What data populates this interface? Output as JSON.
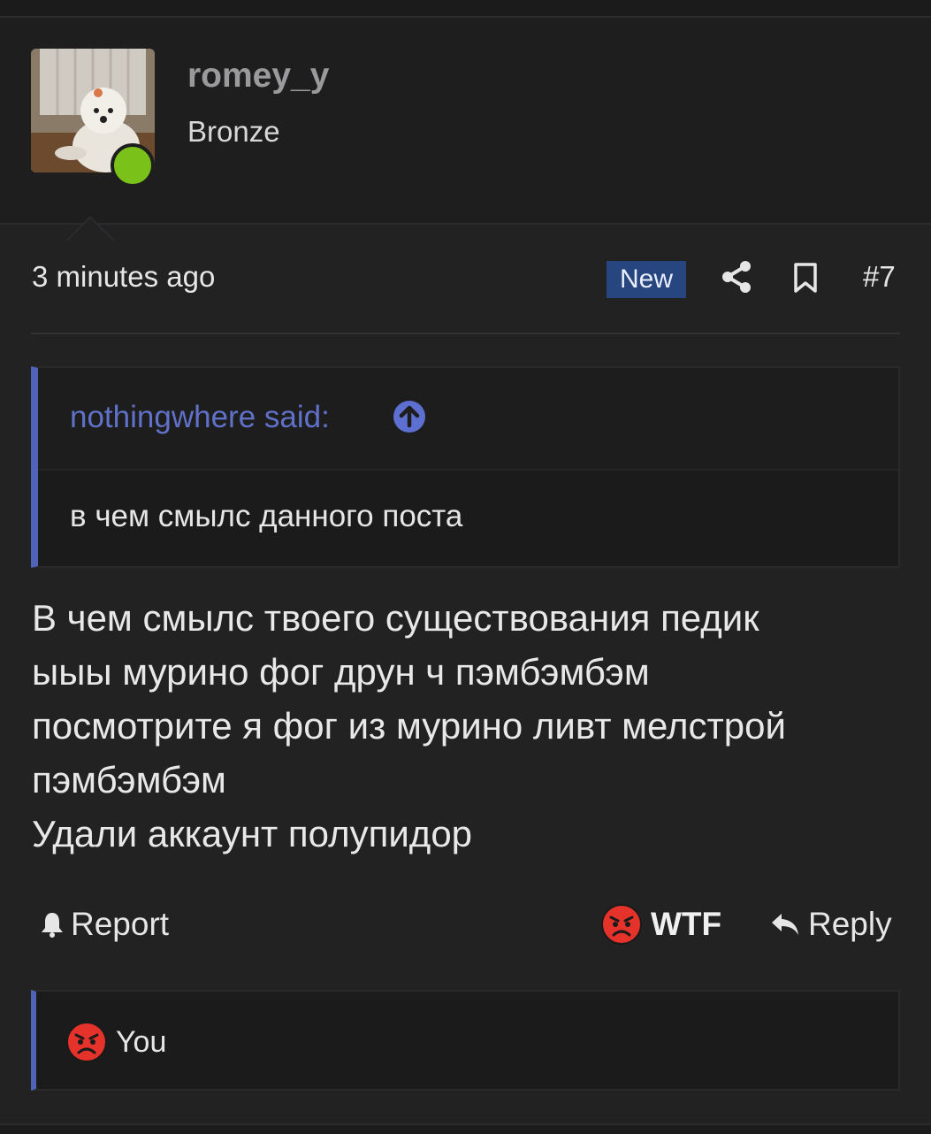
{
  "user": {
    "name": "romey_y",
    "rank": "Bronze",
    "avatar_icon": "dog-avatar",
    "online_color": "#7ac21a"
  },
  "post": {
    "time": "3 minutes ago",
    "badge": "New",
    "badge_color": "#27457f",
    "number": "#7",
    "share_icon": "share-icon",
    "bookmark_icon": "bookmark-icon"
  },
  "quote": {
    "author": "nothingwhere said:",
    "arrow_icon": "arrow-up-circle-icon",
    "text": "в чем смылс данного поста",
    "accent_color": "#4f63b8"
  },
  "message": {
    "lines": [
      "В чем смылс твоего существования педик",
      "ыыы мурино фог друн ч пэмбэмбэм",
      "посмотрите я фог из мурино ливт мелстрой",
      "пэмбэмбэм",
      "Удали аккаунт полупидор"
    ]
  },
  "actions": {
    "report": "Report",
    "reaction": "WTF",
    "reply": "Reply"
  },
  "reactions": {
    "user": "You",
    "emoji_icon": "angry-face-icon"
  }
}
